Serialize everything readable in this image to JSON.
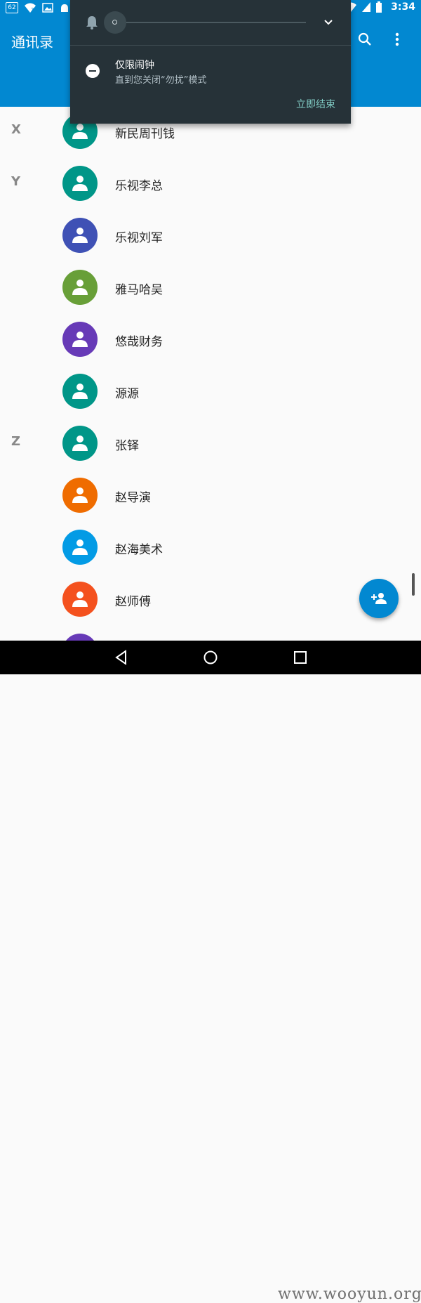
{
  "status_bar": {
    "notification_count": "62",
    "time": "3:34",
    "icons": [
      "wifi-question-icon",
      "image-icon",
      "android-icon",
      "dnd-status-icon",
      "wifi-icon",
      "signal-icon",
      "battery-icon"
    ]
  },
  "app_bar": {
    "title": "通讯录",
    "icons": [
      "search-icon",
      "more-vert-icon"
    ]
  },
  "dnd_panel": {
    "mode_title": "仅限闹钟",
    "mode_subtitle": "直到您关闭“勿扰”模式",
    "end_button": "立即结束",
    "volume_level": 0,
    "icons": [
      "bell-icon",
      "chevron-down-icon",
      "do-not-disturb-icon"
    ]
  },
  "contacts": [
    {
      "letter": "X",
      "name": "新民周刊钱",
      "color": "#009688"
    },
    {
      "letter": "Y",
      "name": "乐视李总",
      "color": "#009688"
    },
    {
      "letter": "",
      "name": "乐视刘军",
      "color": "#3f51b5"
    },
    {
      "letter": "",
      "name": "雅马哈吴",
      "color": "#689f38"
    },
    {
      "letter": "",
      "name": "悠哉财务",
      "color": "#673ab7"
    },
    {
      "letter": "",
      "name": "源源",
      "color": "#009688"
    },
    {
      "letter": "Z",
      "name": "张铎",
      "color": "#009688"
    },
    {
      "letter": "",
      "name": "赵导演",
      "color": "#ef6c00"
    },
    {
      "letter": "",
      "name": "赵海美术",
      "color": "#039be5"
    },
    {
      "letter": "",
      "name": "赵师傅",
      "color": "#f4511e"
    }
  ],
  "colors": {
    "primary": "#0288d1",
    "panel": "#263238",
    "accent": "#80cbc4"
  },
  "fab": {
    "icon": "add-person-icon"
  },
  "nav_bar": {
    "icons": [
      "back-icon",
      "home-icon",
      "recents-icon"
    ]
  },
  "watermark": "www.wooyun.org"
}
